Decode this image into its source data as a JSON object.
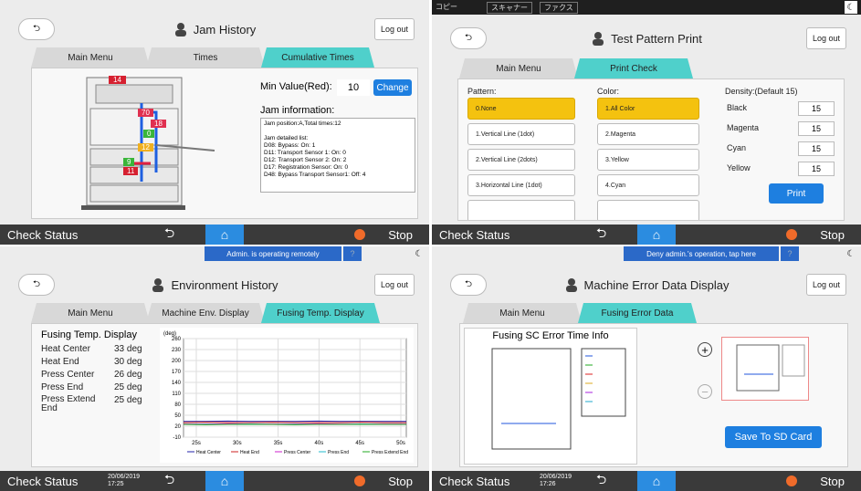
{
  "p1": {
    "title": "Jam History",
    "logout": "Log out",
    "tabs": [
      "Main Menu",
      "Times",
      "Cumulative Times"
    ],
    "min_label": "Min Value(Red):",
    "min_value": "10",
    "change": "Change",
    "jam_info": "Jam information:",
    "jam_text": [
      "Jam position:A,Total times:12",
      "",
      "Jam detailed list:",
      "D08: Bypass: On: 1",
      "D11: Transport Sensor 1: On: 0",
      "D12: Transport Sensor 2: On: 2",
      "D17: Registration Sensor: On: 0",
      "D48: Bypass Transport Sensor1: Off: 4"
    ],
    "badges": [
      "14",
      "70",
      "18",
      "0",
      "12",
      "9",
      "11"
    ]
  },
  "p2": {
    "strip": [
      "コピー",
      "スキャナー",
      "ファクス"
    ],
    "title": "Test Pattern Print",
    "logout": "Log out",
    "tabs": [
      "Main Menu",
      "Print Check"
    ],
    "pattern_label": "Pattern:",
    "color_label": "Color:",
    "density_label": "Density:(Default 15)",
    "patterns": [
      "0.None",
      "1.Vertical Line (1dot)",
      "2.Vertical Line (2dots)",
      "3.Horizontal Line (1dot)"
    ],
    "colors": [
      "1.All Color",
      "2.Magenta",
      "3.Yellow",
      "4.Cyan"
    ],
    "densities": [
      {
        "name": "Black",
        "value": "15"
      },
      {
        "name": "Magenta",
        "value": "15"
      },
      {
        "name": "Cyan",
        "value": "15"
      },
      {
        "name": "Yellow",
        "value": "15"
      }
    ],
    "print": "Print"
  },
  "p3": {
    "banner": "Admin. is operating remotely",
    "title": "Environment History",
    "logout": "Log out",
    "tabs": [
      "Main Menu",
      "Machine Env. Display",
      "Fusing Temp. Display"
    ],
    "section": "Fusing Temp. Display",
    "rows": [
      {
        "k": "Heat Center",
        "v": "33 deg"
      },
      {
        "k": "Heat End",
        "v": "30 deg"
      },
      {
        "k": "Press Center",
        "v": "26 deg"
      },
      {
        "k": "Press End",
        "v": "25 deg"
      },
      {
        "k": "Press Extend End",
        "v": "25 deg"
      }
    ],
    "date": "20/06/2019",
    "time": "17:25"
  },
  "p4": {
    "banner": "Deny admin.'s operation, tap here",
    "title": "Machine Error Data Display",
    "logout": "Log out",
    "tabs": [
      "Main Menu",
      "Fusing Error Data"
    ],
    "chart_title": "Fusing SC Error Time Info",
    "save": "Save To SD Card",
    "date": "20/06/2019",
    "time": "17:26"
  },
  "bottom": {
    "check": "Check Status",
    "stop": "Stop"
  },
  "chart_data": {
    "type": "line",
    "ylabel": "(deg)",
    "yticks": [
      "260",
      "230",
      "200",
      "170",
      "140",
      "110",
      "80",
      "50",
      "20",
      "-10"
    ],
    "xticks": [
      "25s",
      "30s",
      "35s",
      "40s",
      "45s",
      "50s"
    ],
    "ylim": [
      -10,
      260
    ],
    "series": [
      {
        "name": "Heat Center",
        "color": "#2222aa",
        "values": [
          33,
          33,
          34,
          33,
          33,
          33,
          34,
          33,
          33,
          33,
          33
        ]
      },
      {
        "name": "Heat End",
        "color": "#cc2222",
        "values": [
          30,
          31,
          30,
          30,
          31,
          30,
          30,
          30,
          31,
          30,
          30
        ]
      },
      {
        "name": "Press Center",
        "color": "#cc22cc",
        "values": [
          26,
          26,
          27,
          26,
          26,
          26,
          27,
          26,
          26,
          26,
          26
        ]
      },
      {
        "name": "Press End",
        "color": "#22bbcc",
        "values": [
          25,
          25,
          25,
          26,
          25,
          25,
          25,
          25,
          26,
          25,
          25
        ]
      },
      {
        "name": "Press Extend End",
        "color": "#22aa22",
        "values": [
          25,
          24,
          25,
          25,
          25,
          24,
          25,
          25,
          25,
          25,
          25
        ]
      }
    ]
  }
}
